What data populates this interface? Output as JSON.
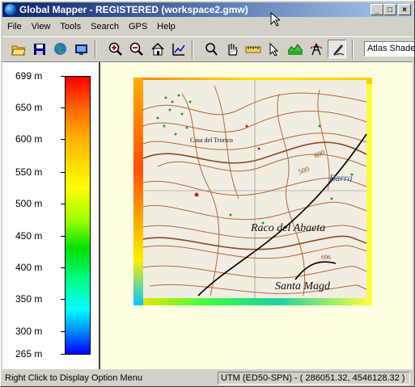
{
  "window": {
    "title": "Global Mapper - REGISTERED (workspace2.gmw)",
    "minimize": "_",
    "maximize": "□",
    "close": "×"
  },
  "menu": [
    {
      "label": "File"
    },
    {
      "label": "View"
    },
    {
      "label": "Tools"
    },
    {
      "label": "Search"
    },
    {
      "label": "GPS"
    },
    {
      "label": "Help"
    }
  ],
  "toolbar": {
    "buttons": [
      "open-folder-icon",
      "save-icon",
      "globe-icon",
      "configure-icon",
      "zoom-in-icon",
      "zoom-out-icon",
      "home-icon",
      "full-view-icon",
      "zoom-tool-icon",
      "pan-hand-icon",
      "measure-ruler-icon",
      "select-arrow-icon",
      "path-profile-icon",
      "power-line-icon",
      "digitizer-icon"
    ],
    "shader_selected": "Atlas Shader"
  },
  "legend": {
    "ticks": [
      "699 m",
      "650 m",
      "600 m",
      "550 m",
      "500 m",
      "450 m",
      "400 m",
      "350 m",
      "300 m",
      "265 m"
    ]
  },
  "map": {
    "labels": {
      "place1": "Casa del Trorico",
      "place2": "Raco del Abaeta",
      "place3": "Santa Magd",
      "place4": "Barra",
      "contour1": "600",
      "contour2": "500",
      "contour3": "696"
    }
  },
  "status": {
    "hint": "Right Click to Display Option Menu",
    "coords": "UTM (ED50-SPN) - ( 286051.32, 4546128.32 )"
  }
}
